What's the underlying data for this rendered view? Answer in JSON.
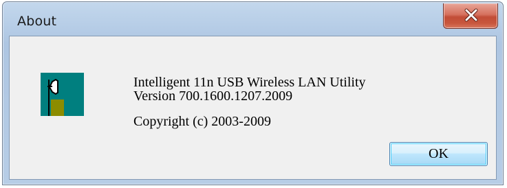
{
  "window": {
    "title": "About"
  },
  "title_bar": {
    "close_icon": "close-x-icon"
  },
  "content": {
    "app_icon": "wireless-adapter-icon",
    "product_name": "Intelligent 11n USB Wireless LAN Utility",
    "version": "Version 700.1600.1207.2009",
    "copyright": "Copyright (c) 2003-2009"
  },
  "buttons": {
    "ok_label": "OK"
  },
  "colors": {
    "close_button_red": "#c24d37",
    "icon_teal": "#007f7f",
    "icon_olive": "#8c8c00",
    "ok_border_blue": "#3c7fb1"
  }
}
